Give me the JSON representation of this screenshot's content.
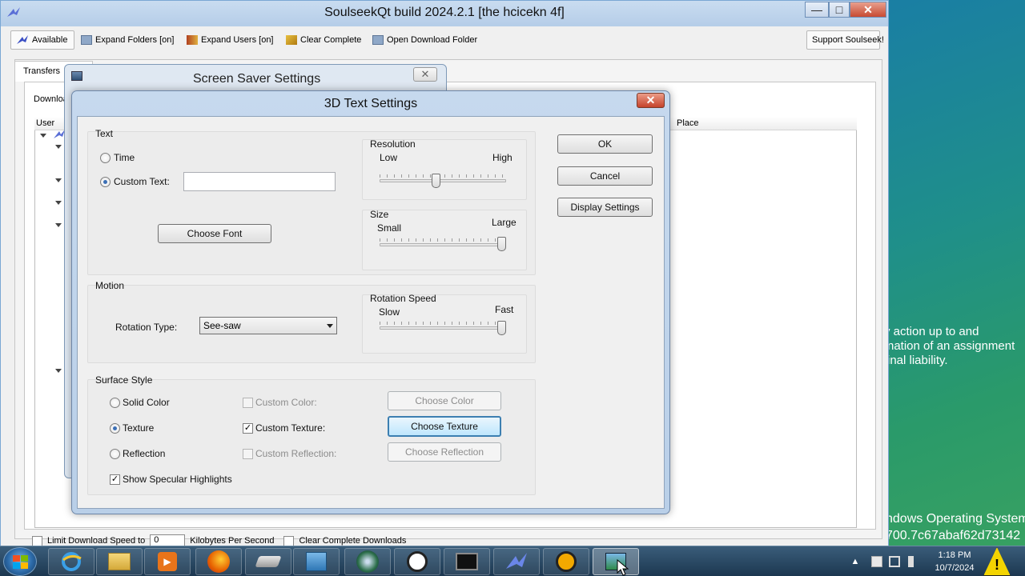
{
  "desktop": {
    "lines": [
      "y action up to and",
      "nation of an assignment",
      "inal liability."
    ],
    "bottom_lines": [
      "ndows Operating System",
      "700.7c67abaf62d73142"
    ]
  },
  "soulseek": {
    "title": "SoulseekQt build 2024.2.1 [the hcicekn 4f]",
    "toolbar": {
      "available": "Available",
      "expand_folders": "Expand Folders [on]",
      "expand_users": "Expand Users [on]",
      "clear_complete": "Clear Complete",
      "open_download_folder": "Open Download Folder",
      "support": "Support Soulseek!"
    },
    "tab_transfers": "Transfers",
    "tab_downloads": "Downloa",
    "columns": {
      "user": "User",
      "place": "Place"
    },
    "bottom": {
      "limit_label": "Limit Download Speed to",
      "limit_value": "0",
      "kbps_label": "Kilobytes Per Second",
      "clear_label": "Clear Complete Downloads"
    }
  },
  "screen_saver": {
    "title": "Screen Saver Settings",
    "close": "✕"
  },
  "dialog": {
    "title": "3D Text Settings",
    "close": "✕",
    "text_group": {
      "title": "Text",
      "time_label": "Time",
      "custom_text_label": "Custom Text:",
      "custom_text_value": "",
      "choose_font": "Choose Font",
      "selected": "custom_text"
    },
    "resolution": {
      "title": "Resolution",
      "low": "Low",
      "high": "High",
      "value": 0.5
    },
    "size": {
      "title": "Size",
      "small": "Small",
      "large": "Large",
      "value": 1.0
    },
    "motion": {
      "title": "Motion",
      "rotation_type_label": "Rotation Type:",
      "rotation_type_value": "See-saw"
    },
    "rotation_speed": {
      "title": "Rotation Speed",
      "slow": "Slow",
      "fast": "Fast",
      "value": 1.0
    },
    "surface": {
      "title": "Surface Style",
      "solid_color": "Solid Color",
      "texture": "Texture",
      "reflection": "Reflection",
      "custom_color": "Custom Color:",
      "custom_texture": "Custom Texture:",
      "custom_reflection": "Custom Reflection:",
      "choose_color": "Choose Color",
      "choose_texture": "Choose Texture",
      "choose_reflection": "Choose Reflection",
      "specular": "Show Specular Highlights",
      "selected": "texture",
      "custom_texture_checked": true,
      "specular_checked": true
    },
    "buttons": {
      "ok": "OK",
      "cancel": "Cancel",
      "display_settings": "Display Settings"
    }
  },
  "taskbar": {
    "time": "1:18 PM",
    "date": "10/7/2024",
    "warning_icon": "!"
  },
  "colors": {
    "accent": "#3c7fb1",
    "title_bar": "#c6d9ee",
    "desktop": "#1a7fa3"
  }
}
